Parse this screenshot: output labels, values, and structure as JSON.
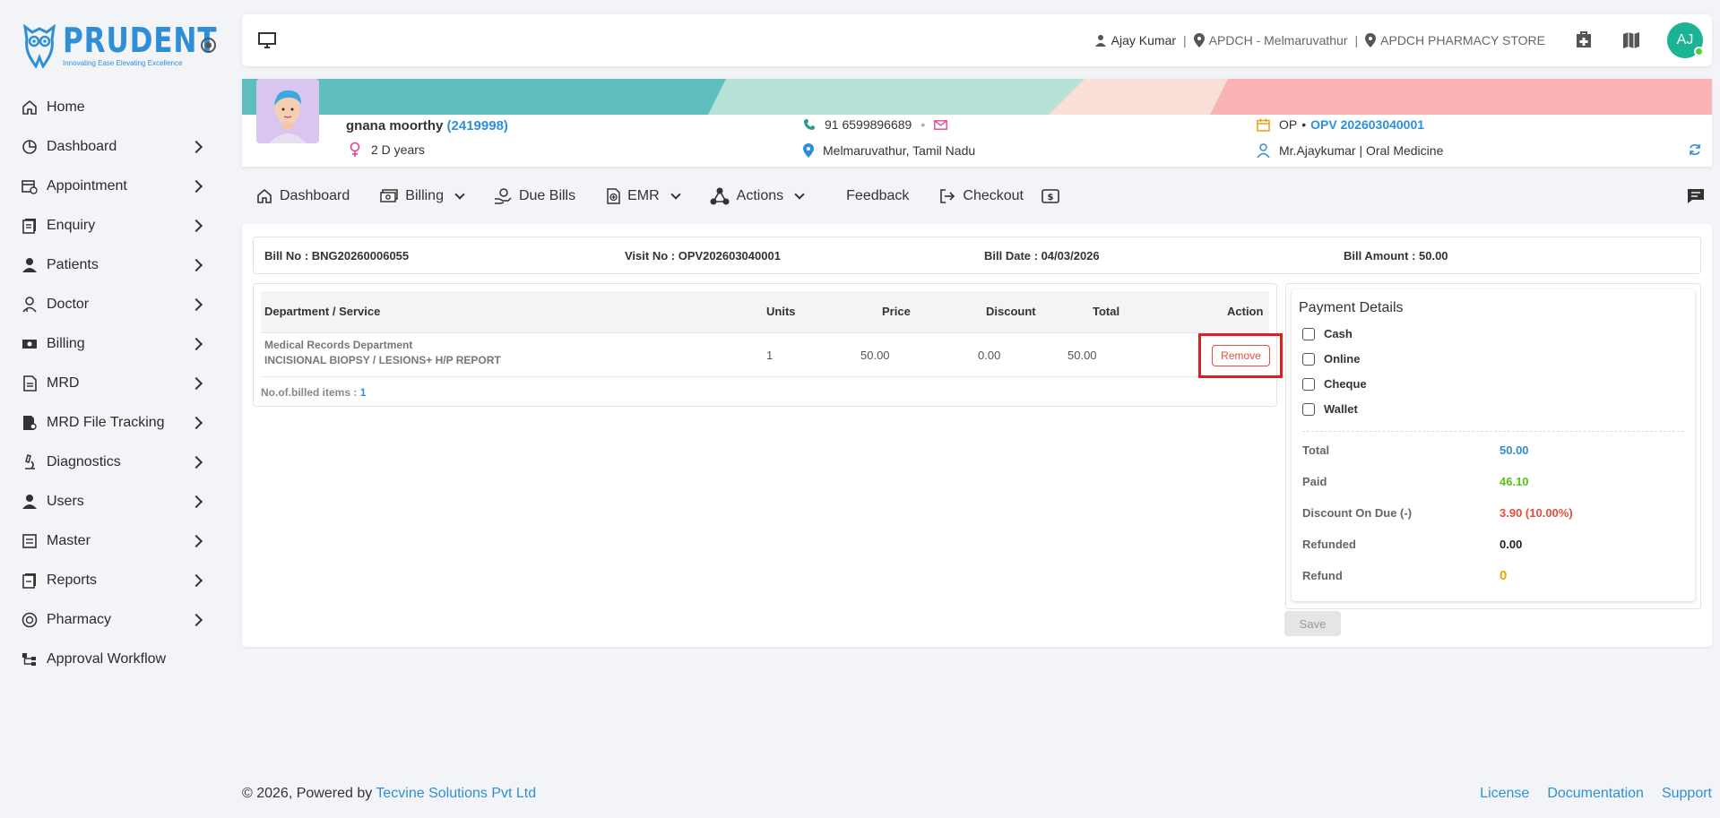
{
  "brand": {
    "name": "PRUDENT",
    "tagline": "Innovating Ease Elevating Excellence"
  },
  "sidebar": {
    "items": [
      {
        "label": "Home",
        "icon": "home-icon"
      },
      {
        "label": "Dashboard",
        "icon": "dashboard-icon"
      },
      {
        "label": "Appointment",
        "icon": "calendar-clock-icon"
      },
      {
        "label": "Enquiry",
        "icon": "document-icon"
      },
      {
        "label": "Patients",
        "icon": "person-icon"
      },
      {
        "label": "Doctor",
        "icon": "doctor-icon"
      },
      {
        "label": "Billing",
        "icon": "money-icon"
      },
      {
        "label": "MRD",
        "icon": "file-icon"
      },
      {
        "label": "MRD File Tracking",
        "icon": "file-search-icon"
      },
      {
        "label": "Diagnostics",
        "icon": "microscope-icon"
      },
      {
        "label": "Users",
        "icon": "person-icon"
      },
      {
        "label": "Master",
        "icon": "list-icon"
      },
      {
        "label": "Reports",
        "icon": "report-icon"
      },
      {
        "label": "Pharmacy",
        "icon": "pharmacy-icon"
      },
      {
        "label": "Approval Workflow",
        "icon": "workflow-icon"
      }
    ]
  },
  "topbar": {
    "user": "Ajay Kumar",
    "branch": "APDCH - Melmaruvathur",
    "store": "APDCH PHARMACY STORE",
    "avatar_initials": "AJ"
  },
  "patient": {
    "name": "gnana moorthy",
    "id": "(2419998)",
    "age": "2 D years",
    "phone": "91 6599896689",
    "location": "Melmaruvathur, Tamil Nadu",
    "visit_type": "OP",
    "visit_no": "OPV 202603040001",
    "doctor": "Mr.Ajaykumar | Oral Medicine"
  },
  "menu": {
    "dashboard": "Dashboard",
    "billing": "Billing",
    "due_bills": "Due Bills",
    "emr": "EMR",
    "actions": "Actions",
    "feedback": "Feedback",
    "checkout": "Checkout"
  },
  "bill": {
    "bill_no": "Bill No : BNG20260006055",
    "visit_no": "Visit No : OPV202603040001",
    "bill_date": "Bill Date : 04/03/2026",
    "bill_amount": "Bill Amount : 50.00"
  },
  "services": {
    "headers": {
      "service": "Department / Service",
      "units": "Units",
      "price": "Price",
      "discount": "Discount",
      "total": "Total",
      "action": "Action"
    },
    "rows": [
      {
        "department": "Medical Records Department",
        "service": "INCISIONAL BIOPSY / LESIONS+ H/P REPORT",
        "units": "1",
        "price": "50.00",
        "discount": "0.00",
        "total": "50.00",
        "action": "Remove"
      }
    ],
    "billed_label": "No.of.billed items :",
    "billed_count": "1"
  },
  "payment": {
    "title": "Payment Details",
    "methods": [
      "Cash",
      "Online",
      "Cheque",
      "Wallet"
    ],
    "total_label": "Total",
    "total": "50.00",
    "paid_label": "Paid",
    "paid": "46.10",
    "discount_label": "Discount On Due (-)",
    "discount": "3.90 (10.00%)",
    "refunded_label": "Refunded",
    "refunded": "0.00",
    "refund_label": "Refund",
    "refund": "0",
    "save": "Save"
  },
  "footer": {
    "copyright": "© 2026, Powered by",
    "company": "Tecvine Solutions Pvt Ltd",
    "license": "License",
    "documentation": "Documentation",
    "support": "Support"
  },
  "colors": {
    "accent": "#2f8fd6",
    "teal": "#1ab394",
    "danger": "#e74c3c",
    "paid": "#52c41a",
    "refund": "#f0a500"
  }
}
